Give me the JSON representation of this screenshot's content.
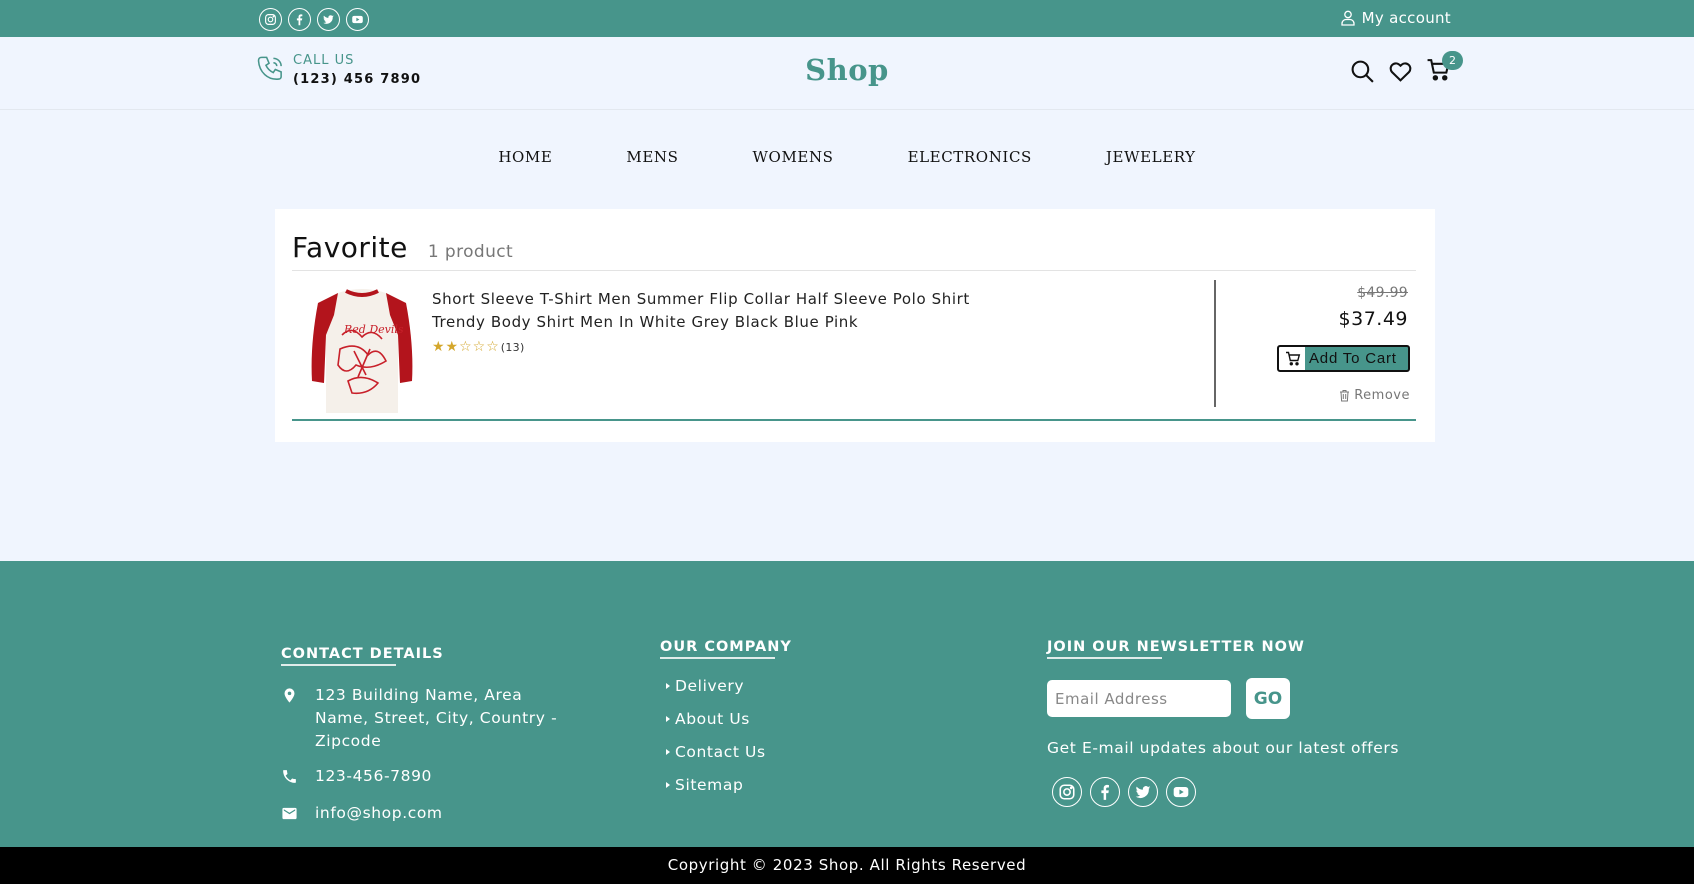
{
  "topbar": {
    "social_icons": [
      "instagram-icon",
      "facebook-icon",
      "twitter-icon",
      "youtube-icon"
    ],
    "account_label": "My account"
  },
  "header": {
    "call_label": "CALL US",
    "call_number": "(123) 456 7890",
    "brand": "Shop",
    "cart_count": "2"
  },
  "nav": {
    "items": [
      {
        "label": "HOME"
      },
      {
        "label": "MENS"
      },
      {
        "label": "WOMENS"
      },
      {
        "label": "ELECTRONICS"
      },
      {
        "label": "JEWELERY"
      }
    ]
  },
  "favorites": {
    "title": "Favorite",
    "count_text": "1 product",
    "items": [
      {
        "name": "Short Sleeve T-Shirt Men Summer Flip Collar Half Sleeve Polo Shirt Trendy Body Shirt Men In White Grey Black Blue Pink",
        "stars": "★★☆☆☆",
        "rating_value": 2,
        "rating_count": "(13)",
        "old_price": "$49.99",
        "price": "$37.49",
        "add_to_cart_label": "Add To Cart",
        "remove_label": "Remove"
      }
    ]
  },
  "footer": {
    "contact": {
      "heading": "CONTACT DETAILS",
      "address": "123 Building Name, Area Name, Street, City, Country - Zipcode",
      "phone": "123-456-7890",
      "email": "info@shop.com"
    },
    "company": {
      "heading": "OUR COMPANY",
      "links": [
        {
          "label": "Delivery"
        },
        {
          "label": "About Us"
        },
        {
          "label": "Contact Us"
        },
        {
          "label": "Sitemap"
        }
      ]
    },
    "newsletter": {
      "heading": "JOIN OUR NEWSLETTER NOW",
      "placeholder": "Email Address",
      "go_label": "GO",
      "text": "Get E-mail updates about our latest offers"
    },
    "copyright": "Copyright © 2023 Shop. All Rights Reserved"
  },
  "colors": {
    "accent": "#47958b",
    "page_bg": "#f0f5fe",
    "footer_bottom": "#000000",
    "star": "#d4a72c"
  }
}
